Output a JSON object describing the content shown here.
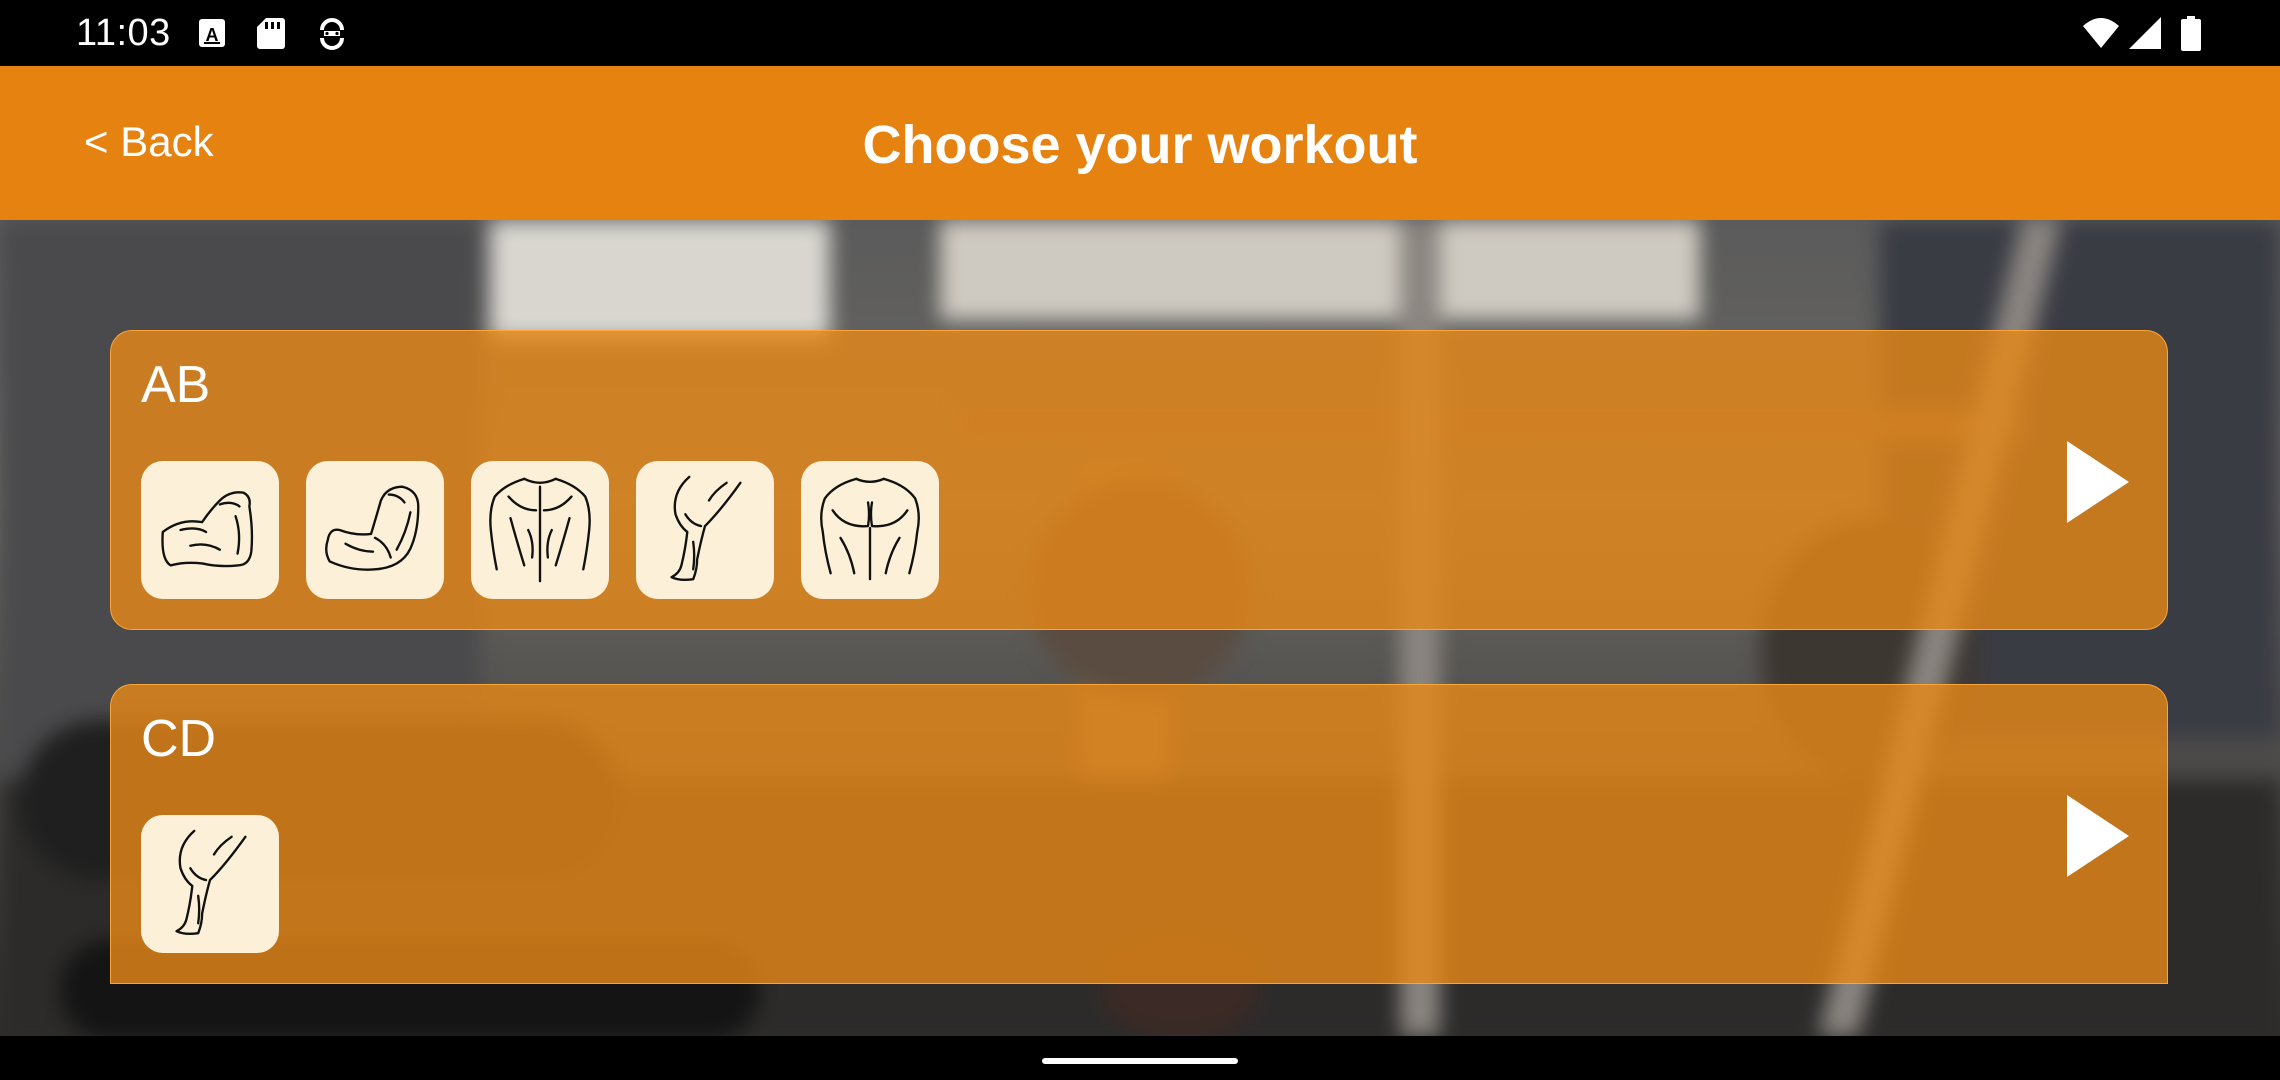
{
  "status_bar": {
    "time": "11:03",
    "icons_left": [
      "a-text-notification-icon",
      "sd-card-icon",
      "sync-icon"
    ],
    "icons_right": [
      "wifi-icon",
      "cell-signal-icon",
      "battery-icon"
    ]
  },
  "header": {
    "back_label": "< Back",
    "title": "Choose your workout",
    "color": "#E6820F"
  },
  "workouts": [
    {
      "name": "AB",
      "muscles": [
        "biceps-icon",
        "arm-icon",
        "back-icon",
        "leg-icon",
        "chest-icon"
      ]
    },
    {
      "name": "CD",
      "muscles": [
        "leg-icon"
      ]
    }
  ],
  "colors": {
    "card": "#E88816",
    "tile": "#FCF1D8",
    "text": "#FFFFFF"
  }
}
